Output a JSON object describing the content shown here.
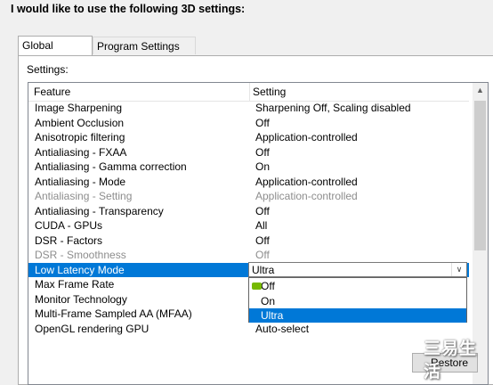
{
  "heading": "I would like to use the following 3D settings:",
  "tabs": [
    {
      "label": "Global Settings",
      "active": true
    },
    {
      "label": "Program Settings",
      "active": false
    }
  ],
  "settings_label": "Settings:",
  "columns": {
    "feature": "Feature",
    "setting": "Setting"
  },
  "rows": [
    {
      "feature": "Image Sharpening",
      "setting": "Sharpening Off, Scaling disabled",
      "disabled": false
    },
    {
      "feature": "Ambient Occlusion",
      "setting": "Off",
      "disabled": false
    },
    {
      "feature": "Anisotropic filtering",
      "setting": "Application-controlled",
      "disabled": false
    },
    {
      "feature": "Antialiasing - FXAA",
      "setting": "Off",
      "disabled": false
    },
    {
      "feature": "Antialiasing - Gamma correction",
      "setting": "On",
      "disabled": false
    },
    {
      "feature": "Antialiasing - Mode",
      "setting": "Application-controlled",
      "disabled": false
    },
    {
      "feature": "Antialiasing - Setting",
      "setting": "Application-controlled",
      "disabled": true
    },
    {
      "feature": "Antialiasing - Transparency",
      "setting": "Off",
      "disabled": false
    },
    {
      "feature": "CUDA - GPUs",
      "setting": "All",
      "disabled": false
    },
    {
      "feature": "DSR - Factors",
      "setting": "Off",
      "disabled": false
    },
    {
      "feature": "DSR - Smoothness",
      "setting": "Off",
      "disabled": true
    },
    {
      "feature": "Low Latency Mode",
      "setting": "Ultra",
      "disabled": false,
      "selected": true
    },
    {
      "feature": "Max Frame Rate",
      "setting": "",
      "disabled": false
    },
    {
      "feature": "Monitor Technology",
      "setting": "",
      "disabled": false
    },
    {
      "feature": "Multi-Frame Sampled AA (MFAA)",
      "setting": "",
      "disabled": false
    },
    {
      "feature": "OpenGL rendering GPU",
      "setting": "Auto-select",
      "disabled": false
    }
  ],
  "combo": {
    "value": "Ultra"
  },
  "dropdown_options": [
    "Off",
    "On",
    "Ultra"
  ],
  "dropdown_highlighted_index": 2,
  "restore_button": "Restore",
  "watermark": "三易生活",
  "colors": {
    "selection": "#0078d7",
    "nvidia_green": "#76b900",
    "disabled_text": "#8d8d8d"
  }
}
